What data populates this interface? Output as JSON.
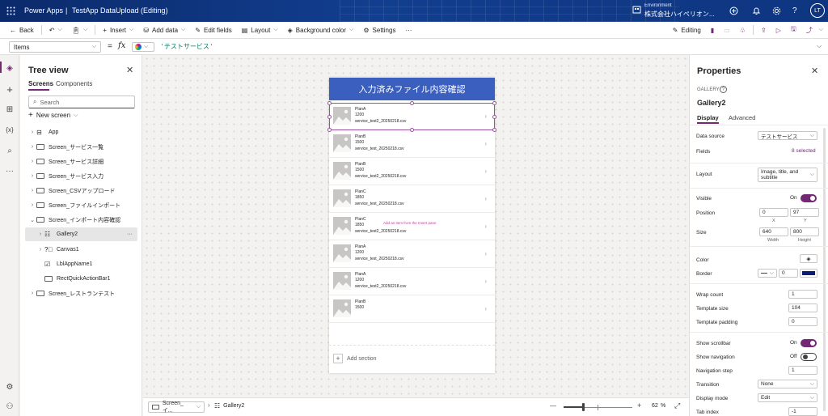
{
  "titlebar": {
    "app_name": "Power Apps",
    "separator": "|",
    "doc_title": "TestApp DataUpload (Editing)",
    "env_label": "Environment",
    "env_name": "株式会社ハイペリオン...",
    "avatar": "LT"
  },
  "command_bar": {
    "back": "Back",
    "insert": "Insert",
    "add_data": "Add data",
    "edit_fields": "Edit fields",
    "layout": "Layout",
    "background_color": "Background color",
    "settings": "Settings",
    "more": "···",
    "editing": "Editing"
  },
  "formula_bar": {
    "property": "Items",
    "equals": "=",
    "fx": "fx",
    "formula": "'テストサービス'"
  },
  "tree": {
    "title": "Tree view",
    "tabs": [
      "Screens",
      "Components"
    ],
    "search_placeholder": "Search",
    "new_screen": "New screen",
    "items": [
      {
        "label": "App"
      },
      {
        "label": "Screen_サービス一覧"
      },
      {
        "label": "Screen_サービス詳細"
      },
      {
        "label": "Screen_サービス入力"
      },
      {
        "label": "Screen_CSVアップロード"
      },
      {
        "label": "Screen_ファイルインポート"
      },
      {
        "label": "Screen_インポート内容確認"
      },
      {
        "label": "Gallery2"
      },
      {
        "label": "Canvas1"
      },
      {
        "label": "LblAppName1"
      },
      {
        "label": "RectQuickActionBar1"
      },
      {
        "label": "Screen_レストランテスト"
      }
    ]
  },
  "screen": {
    "header": "入力済みファイル内容確認",
    "hint": "Add an item from the Insert pane",
    "add_section": "Add section",
    "items": [
      {
        "title": "PlanA",
        "value": "1200",
        "file": "service_test2_20250218.csv"
      },
      {
        "title": "PlanB",
        "value": "1500",
        "file": "service_test_20250218.csv"
      },
      {
        "title": "PlanB",
        "value": "1500",
        "file": "service_test2_20250218.csv"
      },
      {
        "title": "PlanC",
        "value": "1850",
        "file": "service_test_20250218.csv"
      },
      {
        "title": "PlanC",
        "value": "1850",
        "file": "service_test2_20250218.csv"
      },
      {
        "title": "PlanA",
        "value": "1200",
        "file": "service_test_20250218.csv"
      },
      {
        "title": "PlanA",
        "value": "1200",
        "file": "service_test2_20250218.csv"
      },
      {
        "title": "PlanB",
        "value": "1500",
        "file": ""
      }
    ]
  },
  "statusbar": {
    "screen_crumb": "Screen_イ...",
    "gallery_crumb": "Gallery2",
    "minus": "—",
    "plus": "+",
    "zoom": "62",
    "zoom_unit": "%",
    "zoom_level": 0.62
  },
  "props": {
    "title": "Properties",
    "type": "GALLERY",
    "name": "Gallery2",
    "tabs": [
      "Display",
      "Advanced"
    ],
    "data_source_label": "Data source",
    "data_source_value": "テストサービス",
    "fields_label": "Fields",
    "fields_value": "8 selected",
    "layout_label": "Layout",
    "layout_value": "Image, title, and subtitle",
    "visible_label": "Visible",
    "visible_value": "On",
    "position_label": "Position",
    "pos_x": "0",
    "pos_y": "97",
    "x_label": "X",
    "y_label": "Y",
    "size_label": "Size",
    "width": "640",
    "height": "800",
    "width_label": "Width",
    "height_label": "Height",
    "color_label": "Color",
    "border_label": "Border",
    "border_width": "0",
    "border_color": "#0b1c75",
    "wrap_count_label": "Wrap count",
    "wrap_count": "1",
    "template_size_label": "Template size",
    "template_size": "104",
    "template_padding_label": "Template padding",
    "template_padding": "0",
    "show_scrollbar_label": "Show scrollbar",
    "show_scrollbar_value": "On",
    "show_nav_label": "Show navigation",
    "show_nav_value": "Off",
    "nav_step_label": "Navigation step",
    "nav_step": "1",
    "transition_label": "Transition",
    "transition_value": "None",
    "display_mode_label": "Display mode",
    "display_mode_value": "Edit",
    "tab_index_label": "Tab index",
    "tab_index": "-1"
  },
  "colors": {
    "accent": "#742774",
    "header_blue": "#3a5fbf",
    "selection": "#9b4fa0"
  }
}
